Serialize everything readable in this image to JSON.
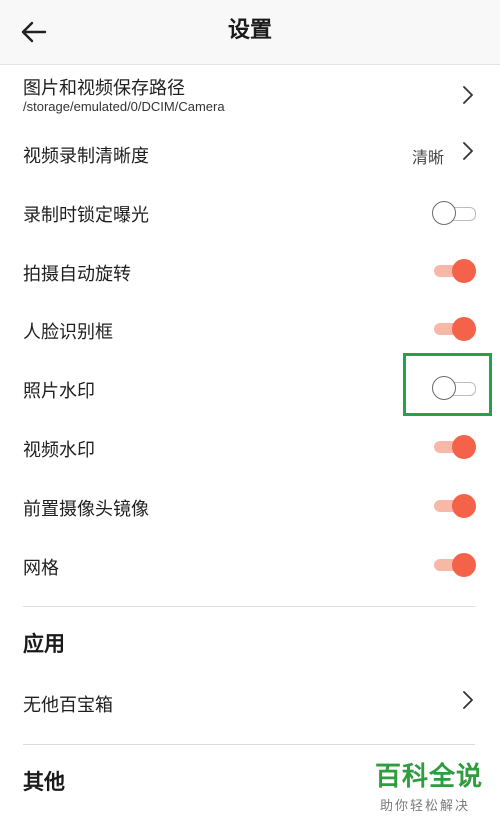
{
  "header": {
    "title": "设置",
    "back_icon": "arrow-left-icon"
  },
  "settings": {
    "save_path": {
      "label": "图片和视频保存路径",
      "value": "/storage/emulated/0/DCIM/Camera"
    },
    "video_quality": {
      "label": "视频录制清晰度",
      "value": "清晰"
    },
    "lock_exposure": {
      "label": "录制时锁定曝光",
      "enabled": false
    },
    "auto_rotate": {
      "label": "拍摄自动旋转",
      "enabled": true
    },
    "face_frame": {
      "label": "人脸识别框",
      "enabled": true
    },
    "photo_watermark": {
      "label": "照片水印",
      "enabled": false
    },
    "video_watermark": {
      "label": "视频水印",
      "enabled": true
    },
    "front_mirror": {
      "label": "前置摄像头镜像",
      "enabled": true
    },
    "grid": {
      "label": "网格",
      "enabled": true
    }
  },
  "apps_section": {
    "title": "应用",
    "toolbox": {
      "label": "无他百宝箱"
    }
  },
  "other_section": {
    "title": "其他"
  },
  "watermark": {
    "brand": "百科全说",
    "slogan": "助你轻松解决"
  },
  "colors": {
    "toggle_on": "#f4624a",
    "toggle_on_track": "#f7b8a8",
    "highlight": "#22a34a",
    "watermark_green": "#2e9c3f"
  }
}
